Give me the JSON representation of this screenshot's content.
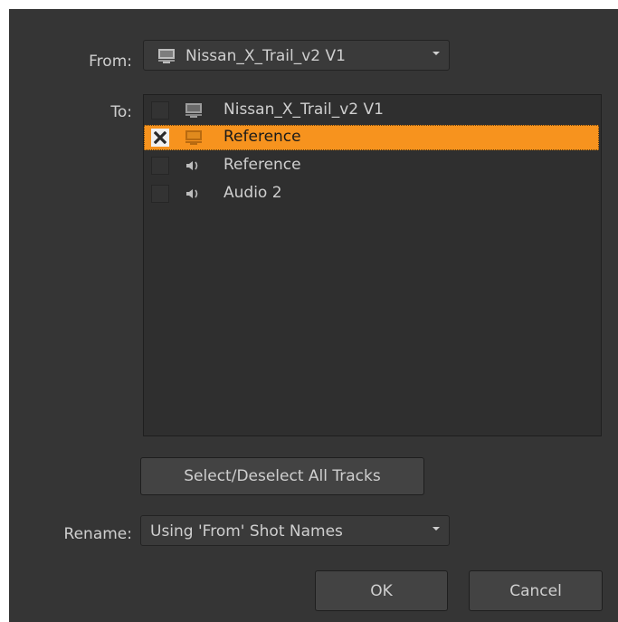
{
  "dialog": {
    "from": {
      "label": "From:",
      "value": "Nissan_X_Trail_v2 V1",
      "icon": "monitor-icon"
    },
    "to": {
      "label": "To:",
      "tracks": [
        {
          "label": "Nissan_X_Trail_v2 V1",
          "icon": "monitor-icon",
          "checked": false,
          "selected": false
        },
        {
          "label": "Reference",
          "icon": "monitor-icon",
          "checked": true,
          "selected": true
        },
        {
          "label": "Reference",
          "icon": "speaker-icon",
          "checked": false,
          "selected": false
        },
        {
          "label": "Audio 2",
          "icon": "speaker-icon",
          "checked": false,
          "selected": false
        }
      ]
    },
    "select_all_label": "Select/Deselect All Tracks",
    "rename": {
      "label": "Rename:",
      "value": "Using 'From' Shot Names"
    },
    "ok_label": "OK",
    "cancel_label": "Cancel"
  },
  "colors": {
    "background": "#353535",
    "selection": "#f7931e",
    "text": "#cfcfcf"
  }
}
